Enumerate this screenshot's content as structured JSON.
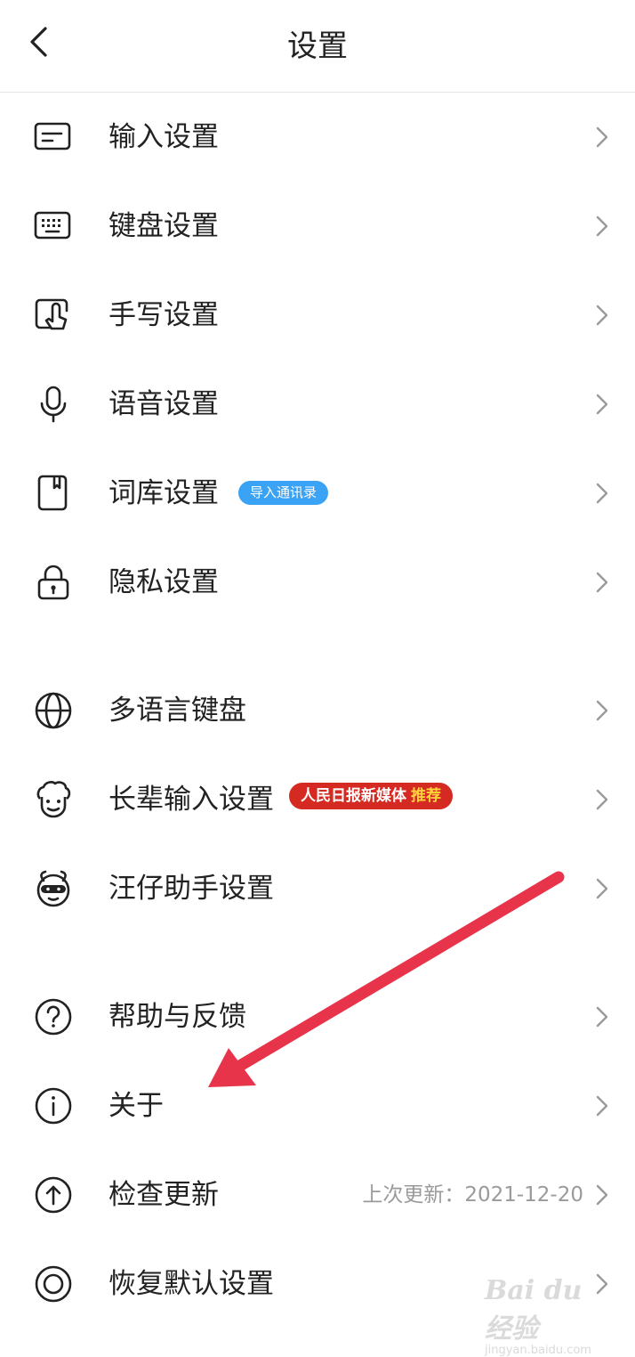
{
  "header": {
    "title": "设置"
  },
  "items": [
    {
      "key": "input",
      "label": "输入设置",
      "icon": "input-settings-icon"
    },
    {
      "key": "keyboard",
      "label": "键盘设置",
      "icon": "keyboard-icon"
    },
    {
      "key": "handwriting",
      "label": "手写设置",
      "icon": "handwriting-icon"
    },
    {
      "key": "voice",
      "label": "语音设置",
      "icon": "microphone-icon"
    },
    {
      "key": "lexicon",
      "label": "词库设置",
      "icon": "book-icon",
      "badge": "导入通讯录"
    },
    {
      "key": "privacy",
      "label": "隐私设置",
      "icon": "lock-icon"
    },
    {
      "key": "multilang",
      "label": "多语言键盘",
      "icon": "globe-icon"
    },
    {
      "key": "elder",
      "label": "长辈输入设置",
      "icon": "elder-face-icon",
      "badge": "人民日报新媒体",
      "badge_tag": "推荐"
    },
    {
      "key": "wangzai",
      "label": "汪仔助手设置",
      "icon": "dog-mascot-icon"
    },
    {
      "key": "help",
      "label": "帮助与反馈",
      "icon": "question-circle-icon"
    },
    {
      "key": "about",
      "label": "关于",
      "icon": "info-circle-icon"
    },
    {
      "key": "update",
      "label": "检查更新",
      "icon": "upload-circle-icon",
      "value": "上次更新：2021-12-20"
    },
    {
      "key": "reset",
      "label": "恢复默认设置",
      "icon": "reset-ring-icon"
    }
  ],
  "watermark": {
    "brand": "Bai du 经验",
    "url": "jingyan.baidu.com"
  },
  "colors": {
    "arrow": "#e8344b",
    "badge_blue": "#3aa3f5",
    "badge_red": "#d42a22",
    "badge_tag": "#ffd43b"
  }
}
